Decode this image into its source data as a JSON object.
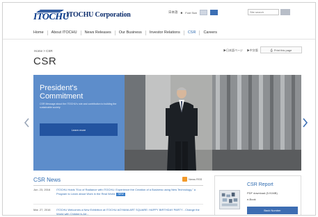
{
  "header": {
    "logo_text": "ITOCHU",
    "corp_name": "ITOCHU Corporation",
    "lang_jp": "日本語",
    "lang_sep": "■",
    "font_size_label": "Font Size",
    "search_placeholder": "Site search"
  },
  "nav": {
    "items": [
      "Home",
      "About ITOCHU",
      "News Releases",
      "Our Business",
      "Investor Relations",
      "CSR",
      "Careers"
    ],
    "active_index": 5
  },
  "breadcrumb": "Home > CSR",
  "page_links": [
    "▶日本語ページ",
    "▶中文版"
  ],
  "print_label": "Print this page",
  "page_title": "CSR",
  "hero": {
    "title_line1": "President's",
    "title_line2": "Commitment",
    "description": "CSR Message about the ITOCHU's role and contribution to building the sustainable society",
    "button_label": "Learn more"
  },
  "news": {
    "title": "CSR News",
    "rss_label": "News RSS",
    "items": [
      {
        "date": "Jun. 23, 2016",
        "text": "ITOCHU Holds \"Eco of Radiance with ITOCHU: Experience the Creation of a Business using New Technology,\" a Program to Learn about Work in the Real World",
        "badge": "NEW"
      },
      {
        "date": "Mar. 27, 2016",
        "text": "ITOCHU Welcomes a New Exhibition at ITOCHU AOYAMA ART SQUARE: HAPPY BIRTHDAY PARTY - Change the World with Children's Art -",
        "badge": ""
      }
    ]
  },
  "report": {
    "title": "CSR Report",
    "pdf_label": "PDF download (5.91MB)",
    "ebook_label": "e-Book",
    "button_label": "Back Number"
  },
  "colors": {
    "brand_blue": "#0b3c8c",
    "link_blue": "#2e6bb0",
    "hero_panel": "#5d8dcb",
    "hero_button": "#2354a0",
    "rss_orange": "#f39a2a"
  }
}
